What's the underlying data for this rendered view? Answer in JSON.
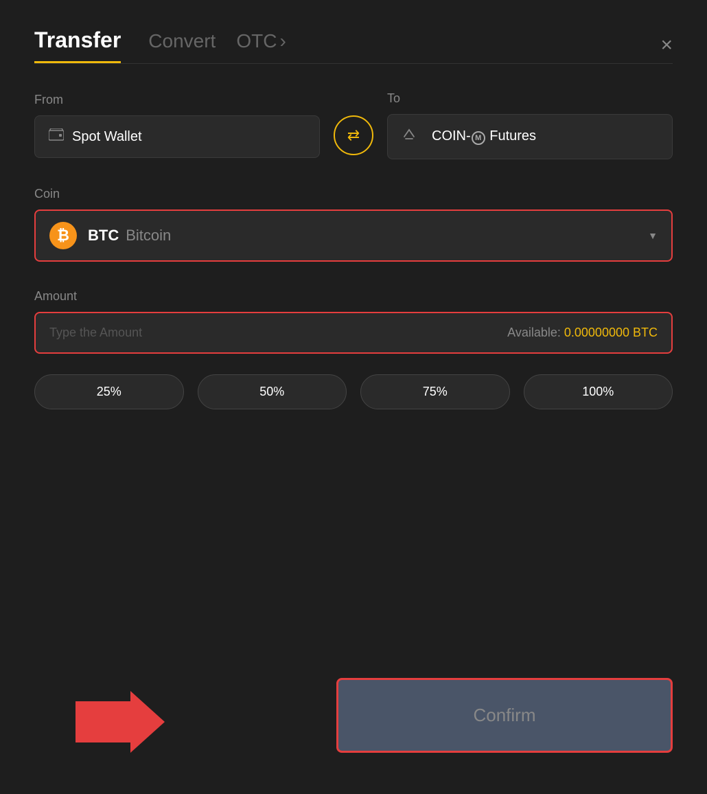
{
  "header": {
    "tab_transfer": "Transfer",
    "tab_convert": "Convert",
    "tab_otc": "OTC",
    "tab_otc_chevron": "›",
    "close_label": "×"
  },
  "from_section": {
    "label": "From",
    "wallet_name": "Spot Wallet"
  },
  "swap": {
    "icon": "⇄"
  },
  "to_section": {
    "label": "To",
    "wallet_name": "COIN-M Futures"
  },
  "coin_section": {
    "label": "Coin",
    "coin_symbol": "BTC",
    "coin_name": "Bitcoin",
    "dropdown_arrow": "▼"
  },
  "amount_section": {
    "label": "Amount",
    "placeholder": "Type the Amount",
    "available_label": "Available:",
    "available_value": "0.00000000 BTC"
  },
  "percentage_buttons": [
    {
      "label": "25%"
    },
    {
      "label": "50%"
    },
    {
      "label": "75%"
    },
    {
      "label": "100%"
    }
  ],
  "confirm_button": {
    "label": "Confirm"
  },
  "colors": {
    "accent_yellow": "#f0b90b",
    "red_highlight": "#e53e3e",
    "btc_orange": "#f7931a"
  }
}
